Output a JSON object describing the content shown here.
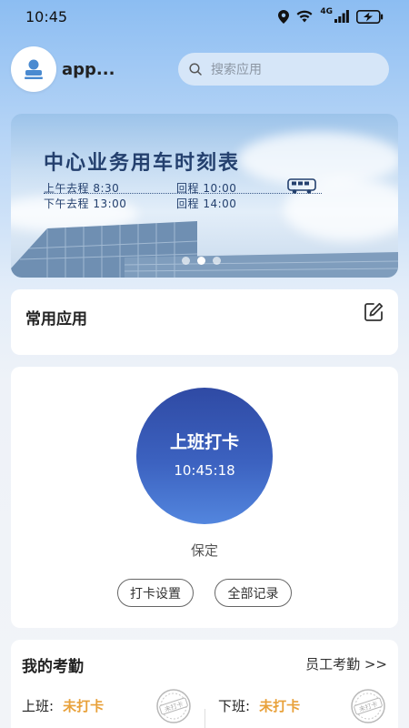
{
  "status_bar": {
    "time": "10:45",
    "network": "4G"
  },
  "header": {
    "app_name": "app...",
    "search_placeholder": "搜索应用"
  },
  "banner": {
    "title": "中心业务用车时刻表",
    "morning_go": "上午去程 8:30",
    "morning_return": "回程 10:00",
    "afternoon_go": "下午去程 13:00",
    "afternoon_return": "回程 14:00",
    "slide_count": 3,
    "active_slide": 2
  },
  "common_apps": {
    "title": "常用应用"
  },
  "clock_in": {
    "button_label": "上班打卡",
    "time": "10:45:18",
    "location": "保定",
    "settings_label": "打卡设置",
    "records_label": "全部记录"
  },
  "attendance": {
    "title": "我的考勤",
    "staff_link": "员工考勤 >>",
    "on_duty_label": "上班:",
    "on_duty_status": "未打卡",
    "off_duty_label": "下班:",
    "off_duty_status": "未打卡",
    "stamp_text": "未打卡"
  },
  "colors": {
    "accent": "#3c62c0",
    "warning": "#e8a13a"
  }
}
